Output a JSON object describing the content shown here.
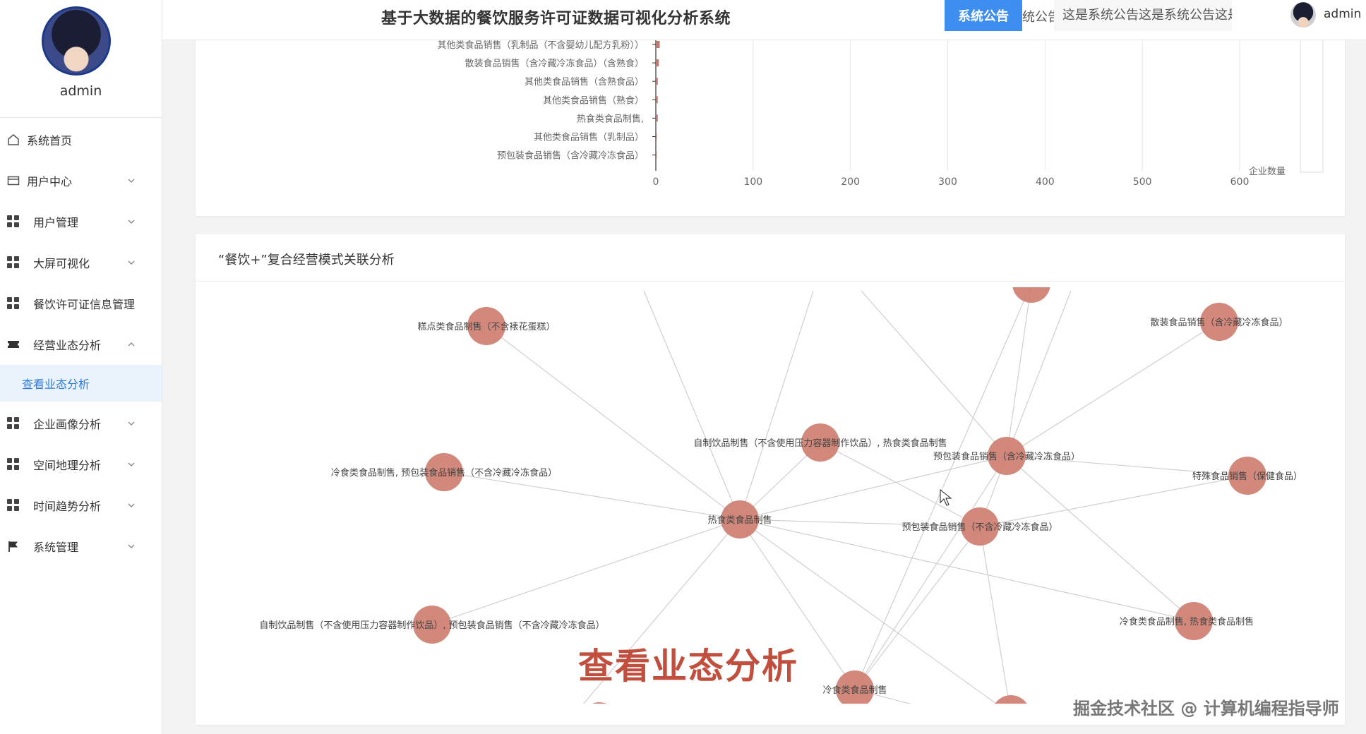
{
  "sidebar": {
    "username": "admin",
    "items": [
      {
        "label": "系统首页",
        "icon": "home-icon",
        "expand": false
      },
      {
        "label": "用户中心",
        "icon": "card-icon",
        "expand": true
      },
      {
        "label": "用户管理",
        "icon": "grid-icon",
        "expand": true
      },
      {
        "label": "大屏可视化",
        "icon": "grid-icon",
        "expand": true
      },
      {
        "label": "餐饮许可证信息管理",
        "icon": "grid-icon",
        "expand": false
      },
      {
        "label": "经营业态分析",
        "icon": "ticket-icon",
        "expand": true,
        "open": true
      },
      {
        "label": "企业画像分析",
        "icon": "grid-icon",
        "expand": true
      },
      {
        "label": "空间地理分析",
        "icon": "grid-icon",
        "expand": true
      },
      {
        "label": "时间趋势分析",
        "icon": "grid-icon",
        "expand": true
      },
      {
        "label": "系统管理",
        "icon": "flag-icon",
        "expand": true
      }
    ],
    "subitem": "查看业态分析"
  },
  "header": {
    "title": "基于大数据的餐饮服务许可证数据可视化分析系统",
    "notice_button": "系统公告",
    "notice_fragment": "统公告",
    "notice_text": "这是系统公告这是系统公告这是系统公告",
    "user": "admin"
  },
  "colors": {
    "accent": "#3d8ef0",
    "active_text": "#2d7bd9",
    "node": "#cd7b6d",
    "bar": "#c0786d",
    "caption": "#c24e3d"
  },
  "chart_data": [
    {
      "type": "bar",
      "orientation": "horizontal",
      "categories": [
        "其他类食品销售（乳制品（不含婴幼儿配方乳粉））",
        "散装食品销售（含冷藏冷冻食品）（含熟食）",
        "其他类食品销售（含熟食品）",
        "其他类食品销售（熟食）",
        "热食类食品制售,",
        "其他类食品销售（乳制品）",
        "预包装食品销售（含冷藏冷冻食品）"
      ],
      "values": [
        4,
        3,
        2,
        2,
        2,
        1,
        1
      ],
      "xticks": [
        "0",
        "100",
        "200",
        "300",
        "400",
        "500",
        "600"
      ],
      "xlim": [
        0,
        600
      ],
      "xlabel": "企业数量"
    },
    {
      "type": "graph",
      "title": "“餐饮+”复合经营模式关联分析",
      "nodes": [
        "糕点类食品制售（不含裱花蛋糕）",
        "散装食品销售（含冷藏冷冻食品）",
        "自制饮品制售（不含使用压力容器制作饮品）, 热食类食品制售",
        "预包装食品销售（含冷藏冷冻食品）",
        "冷食类食品制售, 预包装食品销售（不含冷藏冷冻食品）",
        "特殊食品销售（保健食品）",
        "热食类食品制售",
        "预包装食品销售（不含冷藏冷冻食品）",
        "自制饮品制售（不含使用压力容器制作饮品）, 预包装食品销售（不含冷藏冷冻食品）",
        "冷食类食品制售, 热食类食品制售",
        "冷食类食品制售"
      ],
      "links": [
        [
          0,
          6
        ],
        [
          4,
          6
        ],
        [
          8,
          6
        ],
        [
          2,
          6
        ],
        [
          6,
          7
        ],
        [
          6,
          3
        ],
        [
          6,
          10
        ],
        [
          3,
          1
        ],
        [
          3,
          5
        ],
        [
          3,
          9
        ],
        [
          3,
          10
        ],
        [
          7,
          10
        ],
        [
          2,
          7
        ],
        [
          7,
          5
        ],
        [
          6,
          9
        ],
        [
          3,
          7
        ]
      ]
    }
  ],
  "caption": "查看业态分析",
  "watermark": "掘金技术社区 @ 计算机编程指导师"
}
